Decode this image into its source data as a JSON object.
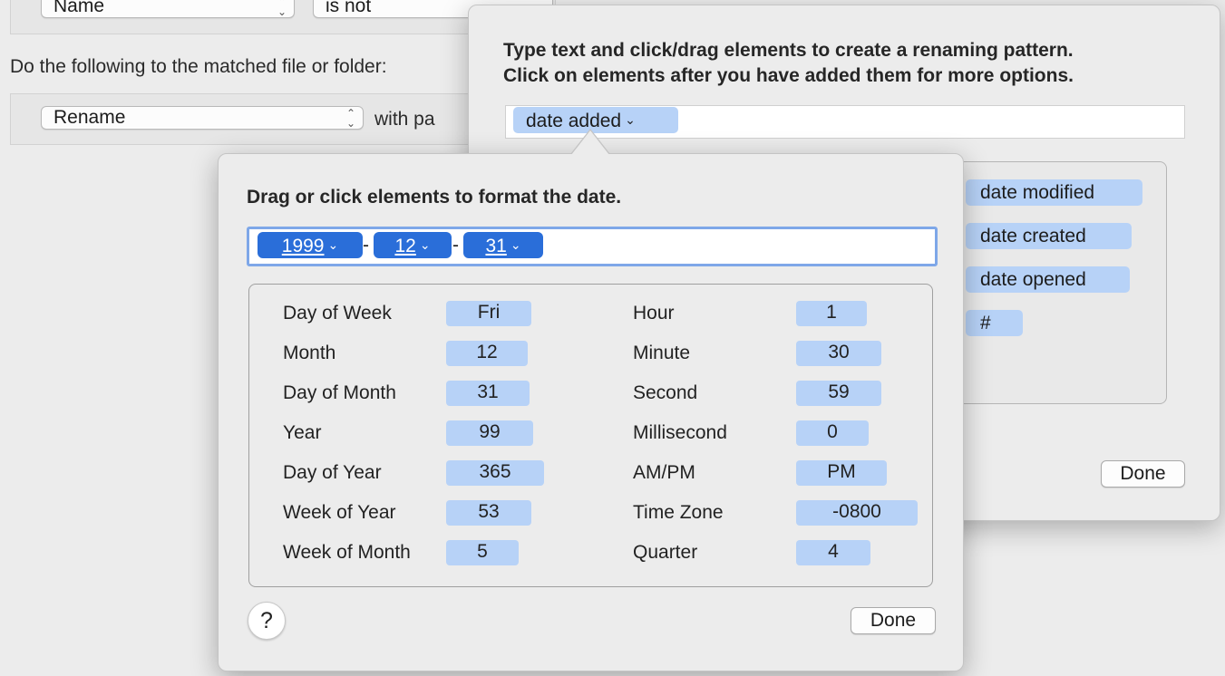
{
  "criteria": {
    "attribute": "Name",
    "operator": "is not"
  },
  "action": {
    "instruction": "Do the following to the matched file or folder:",
    "type": "Rename",
    "with_label": "with pa"
  },
  "pattern_popover": {
    "instruction_line1": "Type text and click/drag elements to create a renaming pattern.",
    "instruction_line2": "Click on elements after you have added them for more options.",
    "pattern_token": "date added",
    "elements": [
      "date modified",
      "date created",
      "date opened",
      "#"
    ],
    "done_label": "Done"
  },
  "date_popover": {
    "instruction": "Drag or click elements to format the date.",
    "format_tokens": [
      "1999",
      "12",
      "31"
    ],
    "separator": "-",
    "left_column": [
      {
        "label": "Day of Week",
        "token": "Fri"
      },
      {
        "label": "Month",
        "token": "12"
      },
      {
        "label": "Day of Month",
        "token": "31"
      },
      {
        "label": "Year",
        "token": "99"
      },
      {
        "label": "Day of Year",
        "token": "365"
      },
      {
        "label": "Week of Year",
        "token": "53"
      },
      {
        "label": "Week of Month",
        "token": "5"
      }
    ],
    "right_column": [
      {
        "label": "Hour",
        "token": "1"
      },
      {
        "label": "Minute",
        "token": "30"
      },
      {
        "label": "Second",
        "token": "59"
      },
      {
        "label": "Millisecond",
        "token": "0"
      },
      {
        "label": "AM/PM",
        "token": "PM"
      },
      {
        "label": "Time Zone",
        "token": "-0800"
      },
      {
        "label": "Quarter",
        "token": "4"
      }
    ],
    "help_label": "?",
    "done_label": "Done"
  },
  "colors": {
    "token_bg": "#b7d2f7",
    "selected_token_bg": "#2a6ed9",
    "field_focus_ring": "#7ea7e8"
  }
}
